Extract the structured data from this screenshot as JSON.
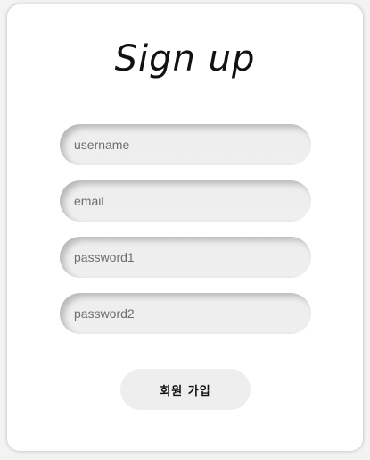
{
  "form": {
    "title": "Sign up",
    "fields": [
      {
        "placeholder": "username",
        "value": ""
      },
      {
        "placeholder": "email",
        "value": ""
      },
      {
        "placeholder": "password1",
        "value": ""
      },
      {
        "placeholder": "password2",
        "value": ""
      }
    ],
    "submit_label": "회원 가입"
  }
}
